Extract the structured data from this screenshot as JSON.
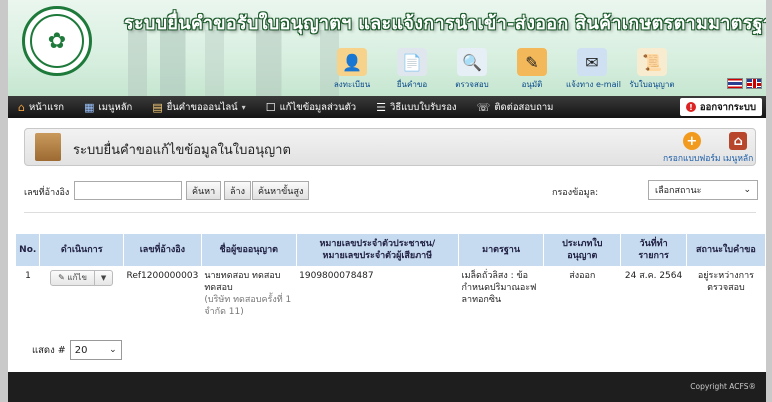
{
  "header": {
    "title": "ระบบยื่นคำขอรับใบอนุญาตฯ และแจ้งการนำเข้า-ส่งออก สินค้าเกษตรตามมาตรฐานบังคับ",
    "quick_nav": [
      {
        "label": "ลงทะเบียน",
        "icon": "register-icon"
      },
      {
        "label": "ยื่นคำขอ",
        "icon": "submit-request-icon"
      },
      {
        "label": "ตรวจสอบ",
        "icon": "search-icon"
      },
      {
        "label": "อนุมัติ",
        "icon": "approve-icon"
      },
      {
        "label": "แจ้งทาง e-mail",
        "icon": "email-icon"
      },
      {
        "label": "รับใบอนุญาต",
        "icon": "certificate-icon"
      }
    ]
  },
  "menu": {
    "items": [
      {
        "label": "หน้าแรก",
        "icon": "home-icon"
      },
      {
        "label": "เมนูหลัก",
        "icon": "grid-icon"
      },
      {
        "label": "ยื่นคำขอออนไลน์",
        "icon": "document-icon",
        "dropdown": "▾"
      },
      {
        "label": "แก้ไขข้อมูลส่วนตัว",
        "icon": "user-edit-icon"
      },
      {
        "label": "วิธีแบบใบรับรอง",
        "icon": "certificate-list-icon"
      },
      {
        "label": "ติดต่อสอบถาม",
        "icon": "contact-icon"
      }
    ],
    "logout": "ออกจากระบบ"
  },
  "panel": {
    "title": "ระบบยื่นคำขอแก้ไขข้อมูลในใบอนุญาต",
    "actions": [
      {
        "label": "กรอกแบบฟอร์ม",
        "icon": "add-icon"
      },
      {
        "label": "เมนูหลัก",
        "icon": "home-icon"
      }
    ]
  },
  "search": {
    "ref_label": "เลขที่อ้างอิง",
    "ref_value": "",
    "search_btn": "ค้นหา",
    "clear_btn": "ล้าง",
    "advanced_btn": "ค้นหาขั้นสูง",
    "filter_label": "กรองข้อมูล:",
    "filter_value": "เลือกสถานะ"
  },
  "table": {
    "headers": [
      "No.",
      "ดำเนินการ",
      "เลขที่อ้างอิง",
      "ชื่อผู้ขออนุญาต",
      "หมายเลขประจำตัวประชาชน/ หมายเลขประจำตัวผู้เสียภาษี",
      "มาตรฐาน",
      "ประเภทใบอนุญาต",
      "วันที่ทำรายการ",
      "สถานะใบคำขอ"
    ],
    "rows": [
      {
        "no": "1",
        "action_edit": "✎ แก้ไข",
        "action_more": "▼",
        "ref": "Ref1200000003",
        "name": "นายทดสอบ ทดสอบ ทดสอบ",
        "company": "(บริษัท ทดสอบครั้งที่ 1 จำกัด 11)",
        "tax_id": "1909800078487",
        "standard": "เมล็ดถั่วลิสง : ข้อกำหนดปริมาณอะฟลาทอกซิน",
        "license_type": "ส่งออก",
        "date": "24 ส.ค. 2564",
        "status": "อยู่ระหว่างการตรวจสอบ"
      }
    ]
  },
  "pager": {
    "label": "แสดง #",
    "value": "20"
  },
  "footer": {
    "copyright": "Copyright ACFS®"
  }
}
